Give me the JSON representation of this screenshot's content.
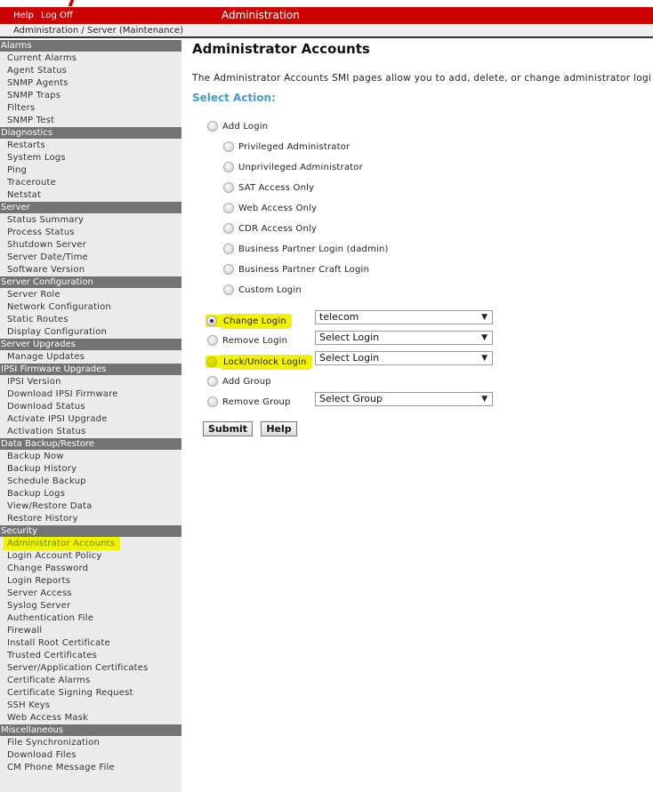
{
  "topbar": {
    "links": [
      "Help",
      "Log Off"
    ],
    "title": "Administration"
  },
  "breadcrumb": "Administration / Server (Maintenance)",
  "sidebar": {
    "sections": [
      {
        "header": "Alarms",
        "items": [
          "Current Alarms",
          "Agent Status",
          "SNMP Agents",
          "SNMP Traps",
          "Filters",
          "SNMP Test"
        ]
      },
      {
        "header": "Diagnostics",
        "items": [
          "Restarts",
          "System Logs",
          "Ping",
          "Traceroute",
          "Netstat"
        ]
      },
      {
        "header": "Server",
        "items": [
          "Status Summary",
          "Process Status",
          "Shutdown Server",
          "Server Date/Time",
          "Software Version"
        ]
      },
      {
        "header": "Server Configuration",
        "items": [
          "Server Role",
          "Network Configuration",
          "Static Routes",
          "Display Configuration"
        ]
      },
      {
        "header": "Server Upgrades",
        "items": [
          "Manage Updates"
        ]
      },
      {
        "header": "IPSI Firmware Upgrades",
        "items": [
          "IPSI Version",
          "Download IPSI Firmware",
          "Download Status",
          "Activate IPSI Upgrade",
          "Activation Status"
        ]
      },
      {
        "header": "Data Backup/Restore",
        "items": [
          "Backup Now",
          "Backup History",
          "Schedule Backup",
          "Backup Logs",
          "View/Restore Data",
          "Restore History"
        ]
      },
      {
        "header": "Security",
        "items": [
          "Administrator Accounts",
          "Login Account Policy",
          "Change Password",
          "Login Reports",
          "Server Access",
          "Syslog Server",
          "Authentication File",
          "Firewall",
          "Install Root Certificate",
          "Trusted Certificates",
          "Server/Application Certificates",
          "Certificate Alarms",
          "Certificate Signing Request",
          "SSH Keys",
          "Web Access Mask"
        ]
      },
      {
        "header": "Miscellaneous",
        "items": [
          "File Synchronization",
          "Download Files",
          "CM Phone Message File"
        ]
      }
    ],
    "active_item": "Administrator Accounts"
  },
  "main": {
    "title": "Administrator Accounts",
    "description": "The Administrator Accounts SMI pages allow you to add, delete, or change administrator logi",
    "select_action_label": "Select Action:",
    "add_login": {
      "label": "Add Login",
      "checked": false,
      "sub_options": [
        "Privileged Administrator",
        "Unprivileged Administrator",
        "SAT Access Only",
        "Web Access Only",
        "CDR Access Only",
        "Business Partner Login (dadmin)",
        "Business Partner Craft Login",
        "Custom Login"
      ]
    },
    "actions": [
      {
        "label": "Change Login",
        "checked": true,
        "highlighted": true,
        "dropdown": "telecom"
      },
      {
        "label": "Remove Login",
        "checked": false,
        "highlighted": false,
        "dropdown": "Select Login"
      },
      {
        "label": "Lock/Unlock Login",
        "checked": false,
        "highlighted": true,
        "dropdown": "Select Login"
      },
      {
        "label": "Add Group",
        "checked": false,
        "highlighted": false,
        "dropdown": null
      },
      {
        "label": "Remove Group",
        "checked": false,
        "highlighted": false,
        "dropdown": "Select Group"
      }
    ],
    "buttons": {
      "submit": "Submit",
      "help": "Help"
    }
  },
  "colors": {
    "topbar_red": "#cc0000",
    "sidebar_header": "#737373",
    "sidebar_bg": "#ececec",
    "highlight_yellow": "#f2f200",
    "select_action_blue": "#4a9ac4"
  },
  "icons": {
    "dropdown_arrow": "▼"
  }
}
